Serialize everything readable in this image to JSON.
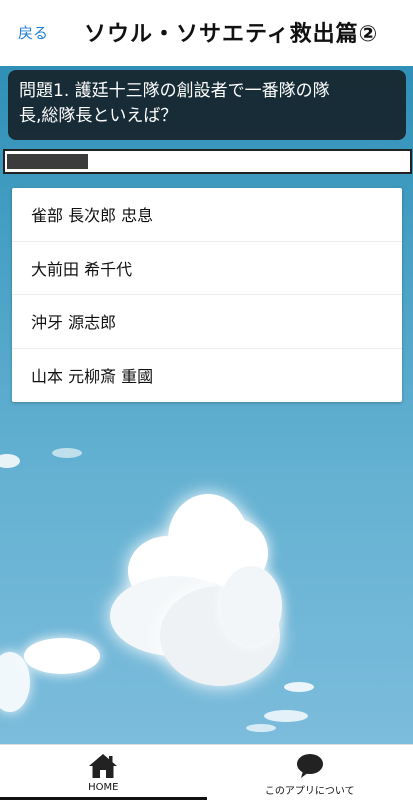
{
  "header": {
    "back_label": "戻る",
    "title": "ソウル・ソサエティ救出篇②"
  },
  "question": {
    "text_line1": "問題1. 護廷十三隊の創設者で一番隊の隊",
    "text_line2": "長,総隊長といえば？"
  },
  "progress": {
    "fraction": 0.2
  },
  "answers": [
    {
      "label": "雀部 長次郎 忠息"
    },
    {
      "label": "大前田 希千代"
    },
    {
      "label": "沖牙 源志郎"
    },
    {
      "label": "山本 元柳斎 重國"
    }
  ],
  "bottom_nav": {
    "items": [
      {
        "label": "HOME",
        "icon": "home-icon",
        "active": true
      },
      {
        "label": "このアプリについて",
        "icon": "speech-bubble-icon",
        "active": false
      }
    ]
  },
  "colors": {
    "accent": "#1f7fd6",
    "question_bg": "#141e24",
    "sky_top": "#2f8fb6",
    "sky_bottom": "#7cbcdc"
  }
}
